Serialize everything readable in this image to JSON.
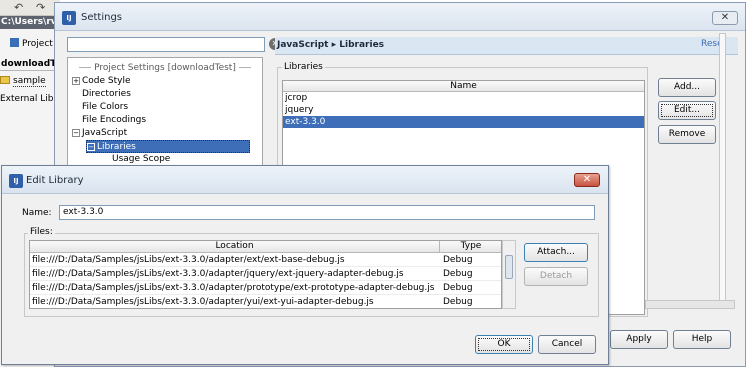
{
  "ide": {
    "path": "C:\\Users\\rv",
    "project_tab": "Project",
    "download_tab": "downloadTe",
    "sample_item": "sample",
    "external_item": "External Libra"
  },
  "settings": {
    "title": "Settings",
    "search_value": "",
    "tree_header": "Project Settings [downloadTest]",
    "tree": [
      "Code Style",
      "Directories",
      "File Colors",
      "File Encodings",
      "JavaScript",
      "Libraries",
      "Usage Scope"
    ],
    "breadcrumb_section": "JavaScript",
    "breadcrumb_page": "Libraries",
    "reset": "Reset",
    "libraries_legend": "Libraries",
    "libraries_column": "Name",
    "libraries": [
      "jcrop",
      "jquery",
      "ext-3.3.0"
    ],
    "selected_library": "ext-3.3.0",
    "add_button": "Add...",
    "edit_button": "Edit...",
    "remove_button": "Remove",
    "apply_button": "Apply",
    "help_button": "Help"
  },
  "edit_library": {
    "title": "Edit Library",
    "name_label": "Name:",
    "name_value": "ext-3.3.0",
    "files_legend": "Files:",
    "col_location": "Location",
    "col_type": "Type",
    "files": [
      {
        "location": "file:///D:/Data/Samples/jsLibs/ext-3.3.0/adapter/ext/ext-base-debug.js",
        "type": "Debug"
      },
      {
        "location": "file:///D:/Data/Samples/jsLibs/ext-3.3.0/adapter/jquery/ext-jquery-adapter-debug.js",
        "type": "Debug"
      },
      {
        "location": "file:///D:/Data/Samples/jsLibs/ext-3.3.0/adapter/prototype/ext-prototype-adapter-debug.js",
        "type": "Debug"
      },
      {
        "location": "file:///D:/Data/Samples/jsLibs/ext-3.3.0/adapter/yui/ext-yui-adapter-debug.js",
        "type": "Debug"
      }
    ],
    "attach_button": "Attach...",
    "detach_button": "Detach",
    "ok_button": "OK",
    "cancel_button": "Cancel"
  },
  "colors": {
    "selection": "#3d6eb7",
    "title_gradient": "#dbe4ef",
    "link": "#3b6cb0"
  }
}
